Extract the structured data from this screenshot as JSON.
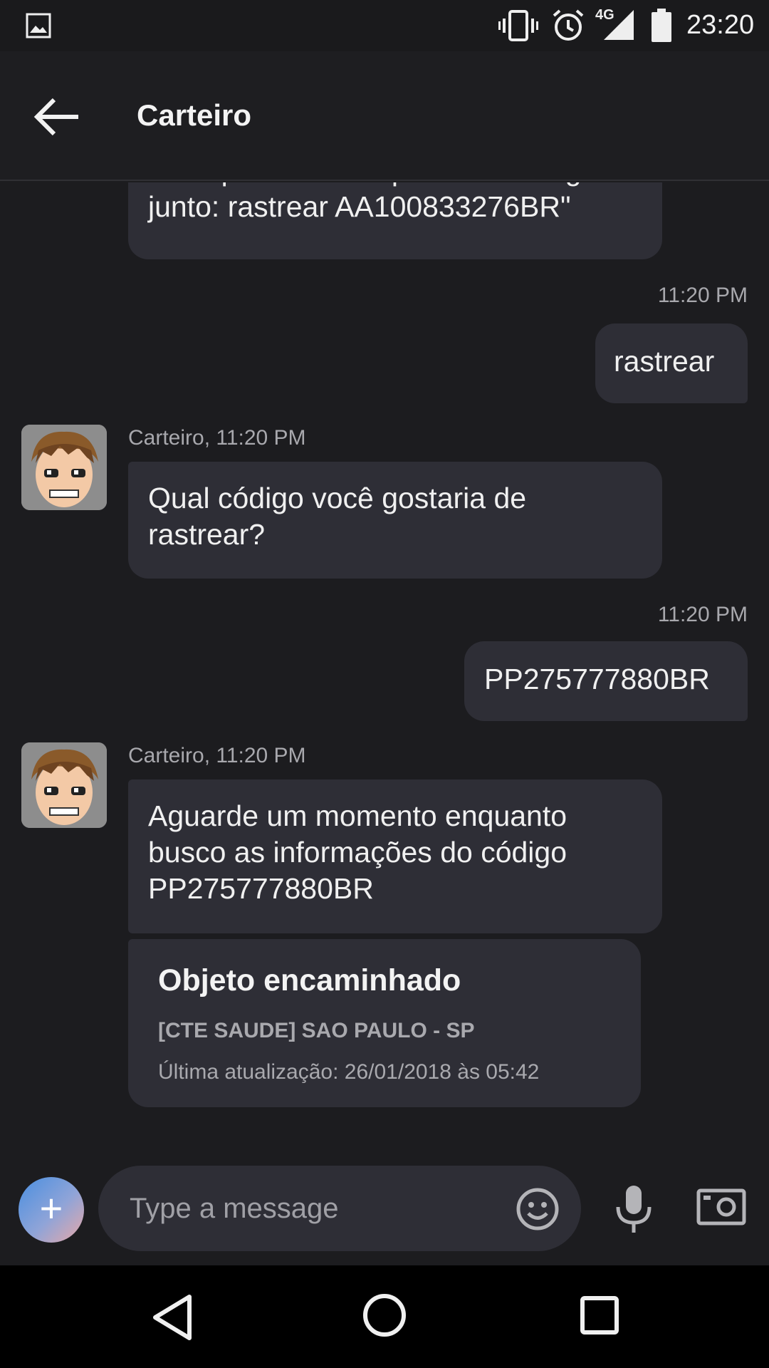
{
  "status_bar": {
    "time": "23:20",
    "network": "4G",
    "icons": [
      "gallery-icon",
      "vibrate-icon",
      "alarm-icon",
      "signal-icon",
      "battery-icon"
    ]
  },
  "app_bar": {
    "title": "Carteiro",
    "back_icon": "arrow-left-icon"
  },
  "messages": [
    {
      "direction": "incoming",
      "lines": [
        "Você pode até me passar o código",
        "junto: rastrear AA100833276BR\""
      ]
    },
    {
      "direction": "outgoing",
      "timestamp": "11:20 PM",
      "text": "rastrear"
    },
    {
      "direction": "incoming",
      "header": "Carteiro, 11:20 PM",
      "lines": [
        "Qual código você gostaria de",
        "rastrear?"
      ]
    },
    {
      "direction": "outgoing",
      "timestamp": "11:20 PM",
      "text": "PP275777880BR"
    },
    {
      "direction": "incoming",
      "header": "Carteiro, 11:20 PM",
      "lines": [
        "Aguarde um momento enquanto",
        "busco as informações do código",
        "PP275777880BR"
      ]
    }
  ],
  "tracking_card": {
    "title": "Objeto encaminhado",
    "location": "[CTE SAUDE] SAO PAULO - SP",
    "updated": "Última atualização: 26/01/2018 às 05:42"
  },
  "composer": {
    "placeholder": "Type a message",
    "icons": [
      "plus-icon",
      "emoji-icon",
      "microphone-icon",
      "camera-icon"
    ]
  },
  "colors": {
    "background": "#1c1c1f",
    "bubble": "#2e2e36",
    "secondary_text": "#a8a8ad"
  }
}
